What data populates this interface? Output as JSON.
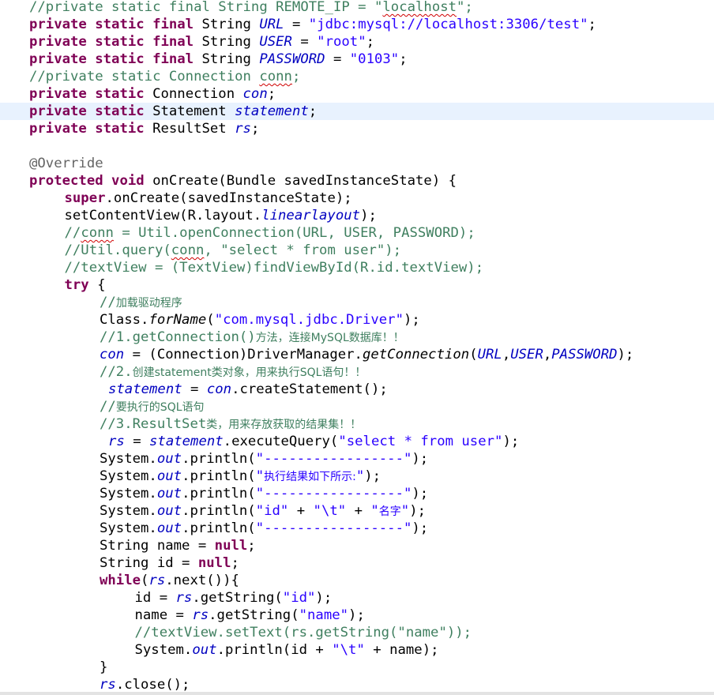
{
  "editor": {
    "highlighted_line_index": 6,
    "colors": {
      "keyword": "#7f0055",
      "comment": "#3f7f5f",
      "string": "#2a00ff",
      "field": "#0000c0",
      "annotation": "#646464",
      "current_line": "#e8f2fe"
    },
    "lines": [
      {
        "indent": 0,
        "tokens": [
          [
            "cmt",
            "//private static final String REMOTE_IP = \""
          ],
          [
            "cmt sq",
            "localhost"
          ],
          [
            "cmt",
            "\";"
          ]
        ]
      },
      {
        "indent": 0,
        "tokens": [
          [
            "kw",
            "private static final"
          ],
          [
            "plain",
            " String "
          ],
          [
            "fld",
            "URL"
          ],
          [
            "plain",
            " = "
          ],
          [
            "str",
            "\"jdbc:mysql://localhost:3306/test\""
          ],
          [
            "plain",
            ";"
          ]
        ]
      },
      {
        "indent": 0,
        "tokens": [
          [
            "kw",
            "private static final"
          ],
          [
            "plain",
            " String "
          ],
          [
            "fld",
            "USER"
          ],
          [
            "plain",
            " = "
          ],
          [
            "str",
            "\"root\""
          ],
          [
            "plain",
            ";"
          ]
        ]
      },
      {
        "indent": 0,
        "tokens": [
          [
            "kw",
            "private static final"
          ],
          [
            "plain",
            " String "
          ],
          [
            "fld",
            "PASSWORD"
          ],
          [
            "plain",
            " = "
          ],
          [
            "str",
            "\"0103\""
          ],
          [
            "plain",
            ";"
          ]
        ]
      },
      {
        "indent": 0,
        "tokens": [
          [
            "cmt",
            "//private static Connection "
          ],
          [
            "cmt sq",
            "conn"
          ],
          [
            "cmt",
            ";"
          ]
        ]
      },
      {
        "indent": 0,
        "tokens": [
          [
            "kw",
            "private static"
          ],
          [
            "plain",
            " Connection "
          ],
          [
            "fld",
            "con"
          ],
          [
            "plain",
            ";"
          ]
        ]
      },
      {
        "indent": 0,
        "tokens": [
          [
            "kw",
            "private static"
          ],
          [
            "plain",
            " Statement "
          ],
          [
            "fld",
            "statement"
          ],
          [
            "plain",
            ";"
          ]
        ]
      },
      {
        "indent": 0,
        "tokens": [
          [
            "kw",
            "private static"
          ],
          [
            "plain",
            " ResultSet "
          ],
          [
            "fld",
            "rs"
          ],
          [
            "plain",
            ";"
          ]
        ]
      },
      {
        "indent": 0,
        "tokens": []
      },
      {
        "indent": 0,
        "tokens": [
          [
            "ann",
            "@Override"
          ]
        ]
      },
      {
        "indent": 0,
        "tokens": [
          [
            "kw",
            "protected void"
          ],
          [
            "plain",
            " onCreate(Bundle savedInstanceState) {"
          ]
        ]
      },
      {
        "indent": 1,
        "tokens": [
          [
            "kw",
            "super"
          ],
          [
            "plain",
            ".onCreate(savedInstanceState);"
          ]
        ]
      },
      {
        "indent": 1,
        "tokens": [
          [
            "plain",
            "setContentView(R.layout."
          ],
          [
            "fld",
            "linearlayout"
          ],
          [
            "plain",
            ");"
          ]
        ]
      },
      {
        "indent": 1,
        "tokens": [
          [
            "cmt",
            "//"
          ],
          [
            "cmt sq",
            "conn"
          ],
          [
            "cmt",
            " = Util.openConnection(URL, USER, PASSWORD);"
          ]
        ]
      },
      {
        "indent": 1,
        "tokens": [
          [
            "cmt",
            "//Util.query("
          ],
          [
            "cmt sq",
            "conn"
          ],
          [
            "cmt",
            ", \"select * from user\");"
          ]
        ]
      },
      {
        "indent": 1,
        "tokens": [
          [
            "cmt",
            "//textView = (TextView)findViewById(R.id.textView);"
          ]
        ]
      },
      {
        "indent": 1,
        "tokens": [
          [
            "kw",
            "try"
          ],
          [
            "plain",
            " {"
          ]
        ]
      },
      {
        "indent": 2,
        "tokens": [
          [
            "cmt",
            "//"
          ],
          [
            "cmt cn",
            "加载驱动程序"
          ]
        ]
      },
      {
        "indent": 2,
        "tokens": [
          [
            "plain",
            "Class."
          ],
          [
            "meth",
            "forName"
          ],
          [
            "plain",
            "("
          ],
          [
            "str",
            "\"com.mysql.jdbc.Driver\""
          ],
          [
            "plain",
            ");"
          ]
        ]
      },
      {
        "indent": 2,
        "tokens": [
          [
            "cmt",
            "//1.getConnection()"
          ],
          [
            "cmt cn",
            "方法，连接MySQL数据库！！"
          ]
        ]
      },
      {
        "indent": 2,
        "tokens": [
          [
            "fld",
            "con"
          ],
          [
            "plain",
            " = (Connection)DriverManager."
          ],
          [
            "meth",
            "getConnection"
          ],
          [
            "plain",
            "("
          ],
          [
            "fld",
            "URL"
          ],
          [
            "plain",
            ","
          ],
          [
            "fld",
            "USER"
          ],
          [
            "plain",
            ","
          ],
          [
            "fld",
            "PASSWORD"
          ],
          [
            "plain",
            ");"
          ]
        ]
      },
      {
        "indent": 2,
        "tokens": [
          [
            "cmt",
            "//2."
          ],
          [
            "cmt cn",
            "创建statement类对象，用来执行SQL语句！！"
          ]
        ]
      },
      {
        "indent": 2,
        "pad": 1,
        "tokens": [
          [
            "fld",
            "statement"
          ],
          [
            "plain",
            " = "
          ],
          [
            "fld",
            "con"
          ],
          [
            "plain",
            ".createStatement();"
          ]
        ]
      },
      {
        "indent": 2,
        "tokens": [
          [
            "cmt",
            "//"
          ],
          [
            "cmt cn",
            "要执行的SQL语句"
          ]
        ]
      },
      {
        "indent": 2,
        "tokens": [
          [
            "cmt",
            "//3.ResultSet"
          ],
          [
            "cmt cn",
            "类，用来存放获取的结果集！！"
          ]
        ]
      },
      {
        "indent": 2,
        "pad": 1,
        "tokens": [
          [
            "fld",
            "rs"
          ],
          [
            "plain",
            " = "
          ],
          [
            "fld",
            "statement"
          ],
          [
            "plain",
            ".executeQuery("
          ],
          [
            "str",
            "\"select * from user\""
          ],
          [
            "plain",
            ");"
          ]
        ]
      },
      {
        "indent": 2,
        "tokens": [
          [
            "plain",
            "System."
          ],
          [
            "fld",
            "out"
          ],
          [
            "plain",
            ".println("
          ],
          [
            "str",
            "\"-----------------\""
          ],
          [
            "plain",
            ");"
          ]
        ]
      },
      {
        "indent": 2,
        "tokens": [
          [
            "plain",
            "System."
          ],
          [
            "fld",
            "out"
          ],
          [
            "plain",
            ".println("
          ],
          [
            "str",
            "\""
          ],
          [
            "str cn",
            "执行结果如下所示:"
          ],
          [
            "str",
            "\""
          ],
          [
            "plain",
            ");"
          ]
        ]
      },
      {
        "indent": 2,
        "tokens": [
          [
            "plain",
            "System."
          ],
          [
            "fld",
            "out"
          ],
          [
            "plain",
            ".println("
          ],
          [
            "str",
            "\"-----------------\""
          ],
          [
            "plain",
            ");"
          ]
        ]
      },
      {
        "indent": 2,
        "tokens": [
          [
            "plain",
            "System."
          ],
          [
            "fld",
            "out"
          ],
          [
            "plain",
            ".println("
          ],
          [
            "str",
            "\"id\""
          ],
          [
            "plain",
            " + "
          ],
          [
            "str",
            "\"\\t\""
          ],
          [
            "plain",
            " + "
          ],
          [
            "str",
            "\""
          ],
          [
            "str cn",
            "名字"
          ],
          [
            "str",
            "\""
          ],
          [
            "plain",
            ");"
          ]
        ]
      },
      {
        "indent": 2,
        "tokens": [
          [
            "plain",
            "System."
          ],
          [
            "fld",
            "out"
          ],
          [
            "plain",
            ".println("
          ],
          [
            "str",
            "\"-----------------\""
          ],
          [
            "plain",
            ");"
          ]
        ]
      },
      {
        "indent": 2,
        "tokens": [
          [
            "plain",
            "String name = "
          ],
          [
            "kw",
            "null"
          ],
          [
            "plain",
            ";"
          ]
        ]
      },
      {
        "indent": 2,
        "tokens": [
          [
            "plain",
            "String id = "
          ],
          [
            "kw",
            "null"
          ],
          [
            "plain",
            ";"
          ]
        ]
      },
      {
        "indent": 2,
        "tokens": [
          [
            "kw",
            "while"
          ],
          [
            "plain",
            "("
          ],
          [
            "fld",
            "rs"
          ],
          [
            "plain",
            ".next()){"
          ]
        ]
      },
      {
        "indent": 3,
        "tokens": [
          [
            "plain",
            "id = "
          ],
          [
            "fld",
            "rs"
          ],
          [
            "plain",
            ".getString("
          ],
          [
            "str",
            "\"id\""
          ],
          [
            "plain",
            ");"
          ]
        ]
      },
      {
        "indent": 3,
        "tokens": [
          [
            "plain",
            "name = "
          ],
          [
            "fld",
            "rs"
          ],
          [
            "plain",
            ".getString("
          ],
          [
            "str",
            "\"name\""
          ],
          [
            "plain",
            ");"
          ]
        ]
      },
      {
        "indent": 3,
        "tokens": [
          [
            "cmt",
            "//textView.setText(rs.getString(\"name\"));"
          ]
        ]
      },
      {
        "indent": 3,
        "tokens": [
          [
            "plain",
            "System."
          ],
          [
            "fld",
            "out"
          ],
          [
            "plain",
            ".println(id + "
          ],
          [
            "str",
            "\"\\t\""
          ],
          [
            "plain",
            " + name);"
          ]
        ]
      },
      {
        "indent": 2,
        "tokens": [
          [
            "plain",
            "}"
          ]
        ]
      },
      {
        "indent": 2,
        "tokens": [
          [
            "fld",
            "rs"
          ],
          [
            "plain",
            ".close();"
          ]
        ]
      }
    ]
  }
}
